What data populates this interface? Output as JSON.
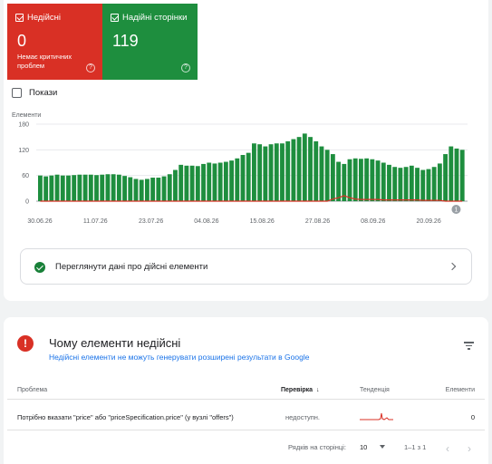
{
  "tiles": {
    "invalid": {
      "label": "Недійсні",
      "count": "0",
      "subtitle": "Немає критичних проблем",
      "help": "?"
    },
    "valid": {
      "label": "Надійні сторінки",
      "count": "119",
      "help": "?"
    }
  },
  "show_label": "Покази",
  "chart_data": {
    "type": "bar",
    "ylabel": "Елементи",
    "yticks": [
      "180",
      "120",
      "60",
      "0"
    ],
    "ylim": [
      0,
      180
    ],
    "xticks": [
      "30.06.26",
      "11.07.26",
      "23.07.26",
      "04.08.26",
      "15.08.26",
      "27.08.26",
      "08.09.26",
      "20.09.26"
    ],
    "annotation": "1",
    "colors": {
      "valid": "#1e8e3e",
      "invalid": "#d93025"
    },
    "series": [
      {
        "name": "Надійні сторінки",
        "values": [
          60,
          58,
          60,
          62,
          60,
          60,
          61,
          62,
          62,
          62,
          61,
          62,
          63,
          63,
          62,
          59,
          56,
          52,
          50,
          52,
          55,
          55,
          58,
          63,
          73,
          85,
          83,
          83,
          82,
          87,
          90,
          88,
          90,
          92,
          95,
          100,
          108,
          113,
          135,
          133,
          128,
          133,
          135,
          135,
          140,
          145,
          150,
          158,
          150,
          140,
          128,
          120,
          110,
          92,
          87,
          98,
          100,
          99,
          100,
          98,
          95,
          90,
          85,
          80,
          78,
          80,
          83,
          78,
          73,
          75,
          80,
          88,
          110,
          128,
          123,
          120
        ]
      },
      {
        "name": "Недійсні",
        "values": [
          0,
          0,
          0,
          0,
          0,
          0,
          0,
          0,
          0,
          0,
          0,
          0,
          0,
          0,
          0,
          0,
          0,
          0,
          0,
          0,
          0,
          0,
          0,
          0,
          0,
          0,
          0,
          0,
          0,
          0,
          0,
          0,
          0,
          0,
          0,
          0,
          0,
          0,
          0,
          0,
          0,
          0,
          0,
          0,
          0,
          0,
          0,
          0,
          0,
          0,
          0,
          0,
          5,
          8,
          13,
          8,
          5,
          4,
          4,
          4,
          4,
          3,
          3,
          3,
          3,
          3,
          3,
          3,
          2,
          2,
          2,
          2,
          0,
          0,
          0,
          0
        ]
      }
    ]
  },
  "link_text": "Переглянути дані про дійсні елементи",
  "issues": {
    "title": "Чому елементи недійсні",
    "subtitle": "Недійсні елементи не можуть генерувати розширені результати в Google",
    "columns": {
      "problem": "Проблема",
      "check": "Перевірка",
      "trend": "Тенденція",
      "items": "Елементи"
    },
    "rows": [
      {
        "problem": "Потрібно вказати \"price\" або \"priceSpecification.price\" (у вузлі \"offers\")",
        "check": "недоступн.",
        "items": "0"
      }
    ],
    "pager": {
      "rows_label": "Рядків на сторінці:",
      "rows_value": "10",
      "range": "1–1 з 1"
    }
  }
}
